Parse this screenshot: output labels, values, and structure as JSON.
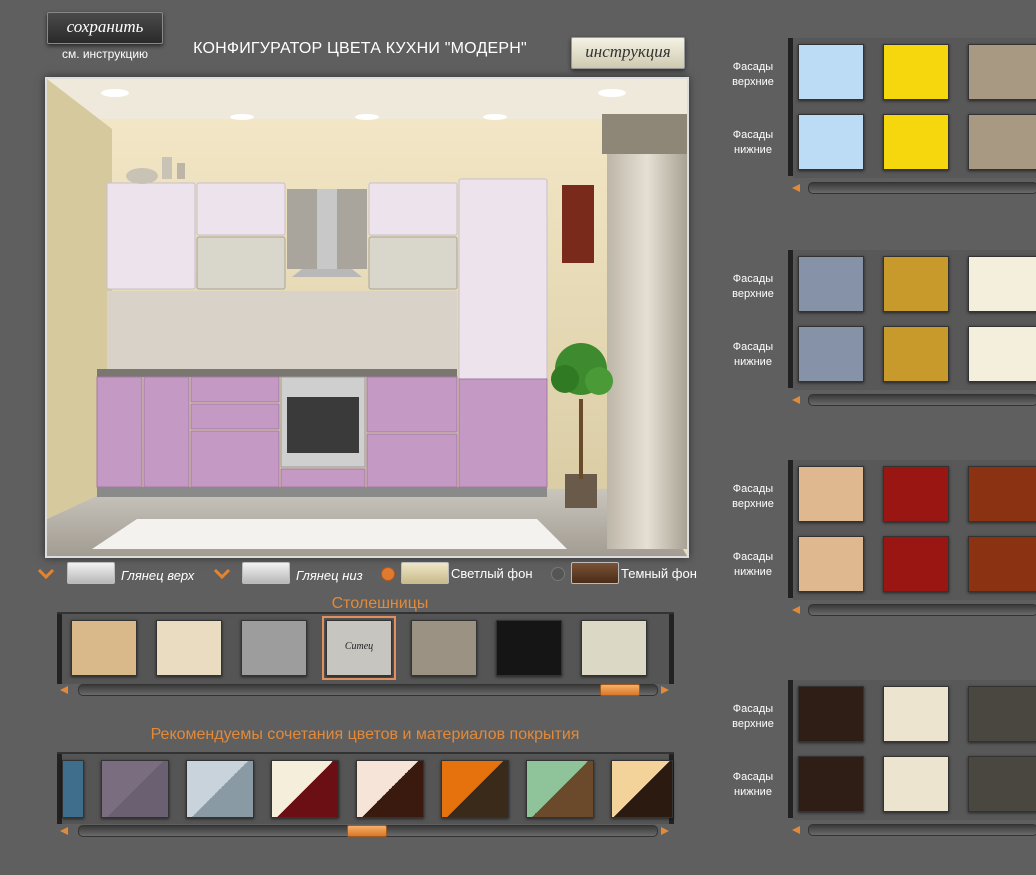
{
  "header": {
    "save_label": "сохранить",
    "save_hint": "см. инструкцию",
    "title": "КОНФИГУРАТОР ЦВЕТА КУХНИ \"МОДЕРН\"",
    "instruction_label": "инструкция"
  },
  "finish": {
    "upper_label": "Глянец верх",
    "lower_label": "Глянец низ",
    "light_bg_label": "Светлый фон",
    "dark_bg_label": "Темный фон",
    "selected_background": "Светлый фон"
  },
  "countertops": {
    "title": "Столешницы",
    "selected_label": "Ситец",
    "scroll_position": 0.97,
    "colors": [
      "#d9b98a",
      "#e9dcc0",
      "#9d9d9d",
      "#c7c5c0",
      "#9c9283",
      "#151515",
      "#dcd8c6"
    ]
  },
  "combos": {
    "title": "Рекомендуемы сочетания цветов и материалов покрытия",
    "scroll_position": 0.5,
    "items": [
      [
        "#3f6d8c",
        "#3f6d8c"
      ],
      [
        "#7a6d80",
        "#6b5f72"
      ],
      [
        "#c9d3dc",
        "#8a9aa4"
      ],
      [
        "#f4eedb",
        "#6b0f14"
      ],
      [
        "#f6e4d8",
        "#3a1a0f"
      ],
      [
        "#e6720e",
        "#3a2a1a"
      ],
      [
        "#8fc49a",
        "#6a4a2a"
      ],
      [
        "#f4d39a",
        "#2a1a10"
      ]
    ]
  },
  "facade_panels": [
    {
      "upper_label": "Фасады верхние",
      "lower_label": "Фасады нижние",
      "colors": [
        "#bcdcf6",
        "#f6d70e",
        "#a89a82"
      ]
    },
    {
      "upper_label": "Фасады верхние",
      "lower_label": "Фасады нижние",
      "colors": [
        "#8592a8",
        "#c89a2c",
        "#f3efdc"
      ]
    },
    {
      "upper_label": "Фасады верхние",
      "lower_label": "Фасады нижние",
      "colors": [
        "#e0b890",
        "#9a1612",
        "#8a3212"
      ]
    },
    {
      "upper_label": "Фасады верхние",
      "lower_label": "Фасады нижние",
      "colors": [
        "#2e1e16",
        "#ece4cf",
        "#4a4640"
      ]
    }
  ],
  "kitchen": {
    "upper_cabinet_color": "#ece3ec",
    "lower_cabinet_color": "#c49ac4",
    "wall_color": "#e8dcb8"
  }
}
